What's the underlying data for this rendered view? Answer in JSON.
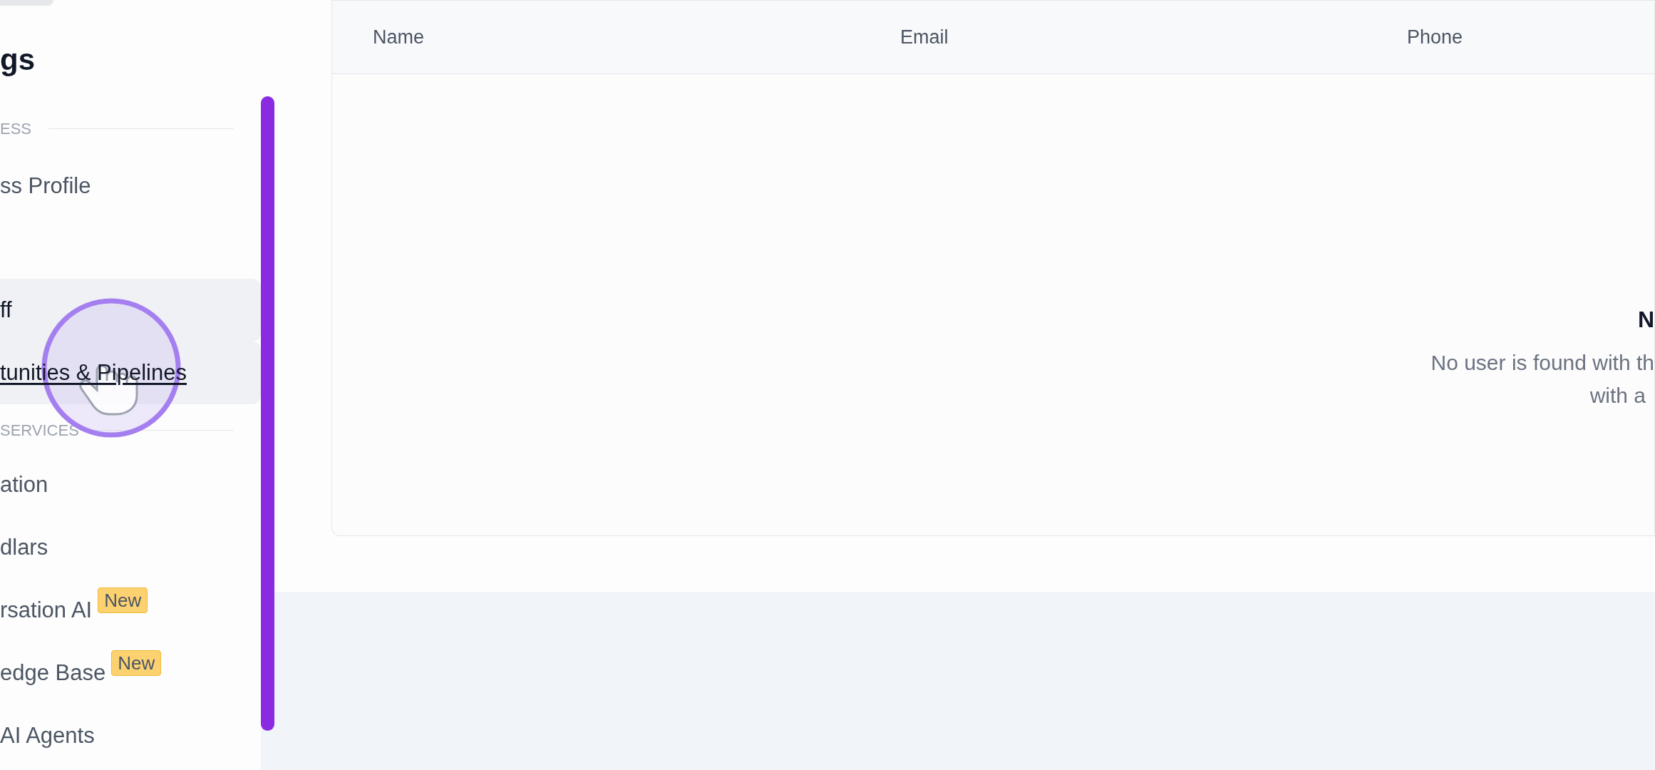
{
  "sidebar": {
    "title": "gs",
    "sections": [
      {
        "label": "ESS",
        "items": [
          {
            "label": "ss Profile",
            "highlighted": false,
            "hovered": false
          },
          {
            "label": "ff",
            "highlighted": true,
            "hovered": false
          },
          {
            "label": "tunities & Pipelines",
            "highlighted": true,
            "hovered": true
          }
        ]
      },
      {
        "label": "SERVICES",
        "items": [
          {
            "label": "ation",
            "highlighted": false,
            "hovered": false
          },
          {
            "label": "dlars",
            "highlighted": false,
            "hovered": false
          },
          {
            "label": "rsation AI",
            "badge": "New",
            "highlighted": false,
            "hovered": false
          },
          {
            "label": "edge Base",
            "badge": "New",
            "highlighted": false,
            "hovered": false
          },
          {
            "label": "AI Agents",
            "highlighted": false,
            "hovered": false
          }
        ]
      }
    ]
  },
  "table": {
    "columns": [
      "Name",
      "Email",
      "Phone"
    ],
    "empty_state": {
      "title": "N",
      "lines": [
        "No user is found with th",
        "with a"
      ]
    }
  }
}
